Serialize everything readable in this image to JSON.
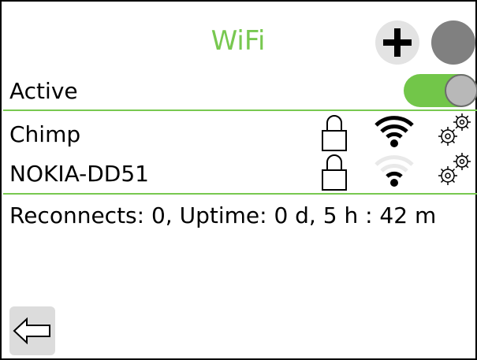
{
  "header": {
    "title": "WiFi",
    "add_icon": "plus-icon",
    "menu_icon": "circle-icon",
    "accent_color": "#78c850"
  },
  "active_row": {
    "label": "Active",
    "toggle_on": true
  },
  "networks": [
    {
      "ssid": "Chimp",
      "locked": true,
      "signal_bars": 3,
      "signal_max": 3
    },
    {
      "ssid": "NOKIA-DD51",
      "locked": true,
      "signal_bars": 1,
      "signal_max": 3
    }
  ],
  "status": {
    "text": "Reconnects: 0, Uptime: 0 d, 5 h : 42 m"
  },
  "footer": {
    "back_icon": "back-arrow-icon"
  }
}
